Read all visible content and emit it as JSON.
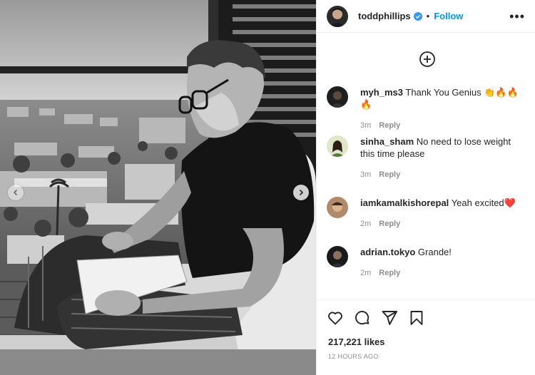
{
  "post": {
    "author": "toddphillips",
    "verified": true,
    "separator": "•",
    "follow_label": "Follow",
    "more_label": "•••",
    "likes": "217,221 likes",
    "timestamp": "12 HOURS AGO"
  },
  "comments": [
    {
      "user": "myh_ms3",
      "text": "Thank You Genius 👏🔥🔥🔥",
      "age": "3m",
      "reply_label": "Reply"
    },
    {
      "user": "sinha_sham",
      "text": "No need to lose weight this time please",
      "age": "3m",
      "reply_label": "Reply"
    },
    {
      "user": "iamkamalkishorepal",
      "text": "Yeah excited❤️",
      "age": "2m",
      "reply_label": "Reply"
    },
    {
      "user": "adrian.tokyo",
      "text": "Grande!",
      "age": "2m",
      "reply_label": "Reply"
    }
  ],
  "icons": {
    "load_more": "plus-circle-icon",
    "like": "heart-icon",
    "comment": "comment-icon",
    "share": "send-icon",
    "save": "bookmark-icon",
    "more": "ellipsis-icon",
    "verified": "verified-badge-icon",
    "prev": "chevron-left-icon",
    "next": "chevron-right-icon"
  },
  "colors": {
    "accent": "#0095f6",
    "text": "#262626",
    "muted": "#8e8e8e",
    "divider": "#efefef"
  }
}
